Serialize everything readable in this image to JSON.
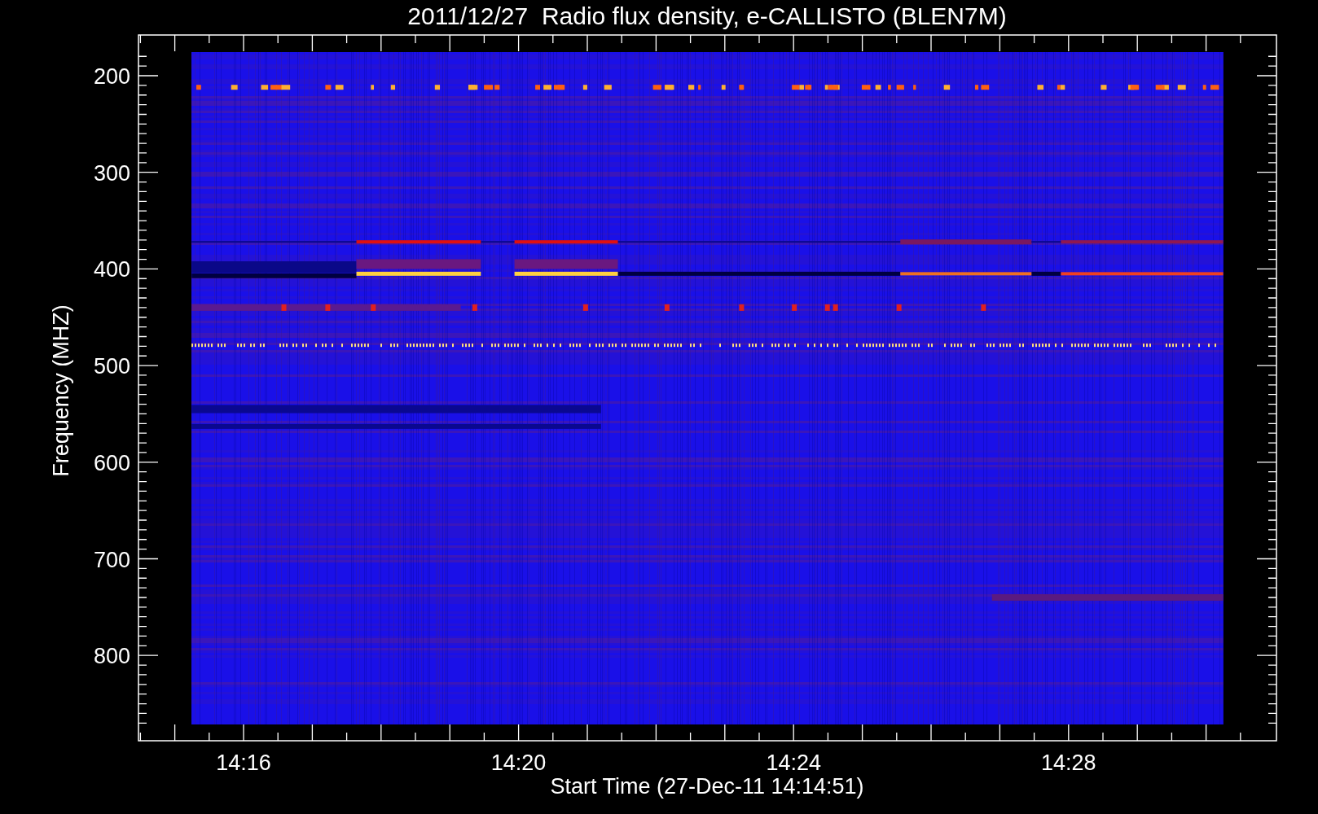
{
  "plot": {
    "title": "2011/12/27  Radio flux density, e-CALLISTO (BLEN7M)",
    "ylabel": "Frequency (MHZ)",
    "yticks": [
      "200",
      "300",
      "400",
      "500",
      "600",
      "700",
      "800"
    ],
    "xticks": [
      "14:16",
      "14:20",
      "14:24",
      "14:28"
    ],
    "xlabel": "Start Time (27-Dec-11 14:14:51)"
  }
}
